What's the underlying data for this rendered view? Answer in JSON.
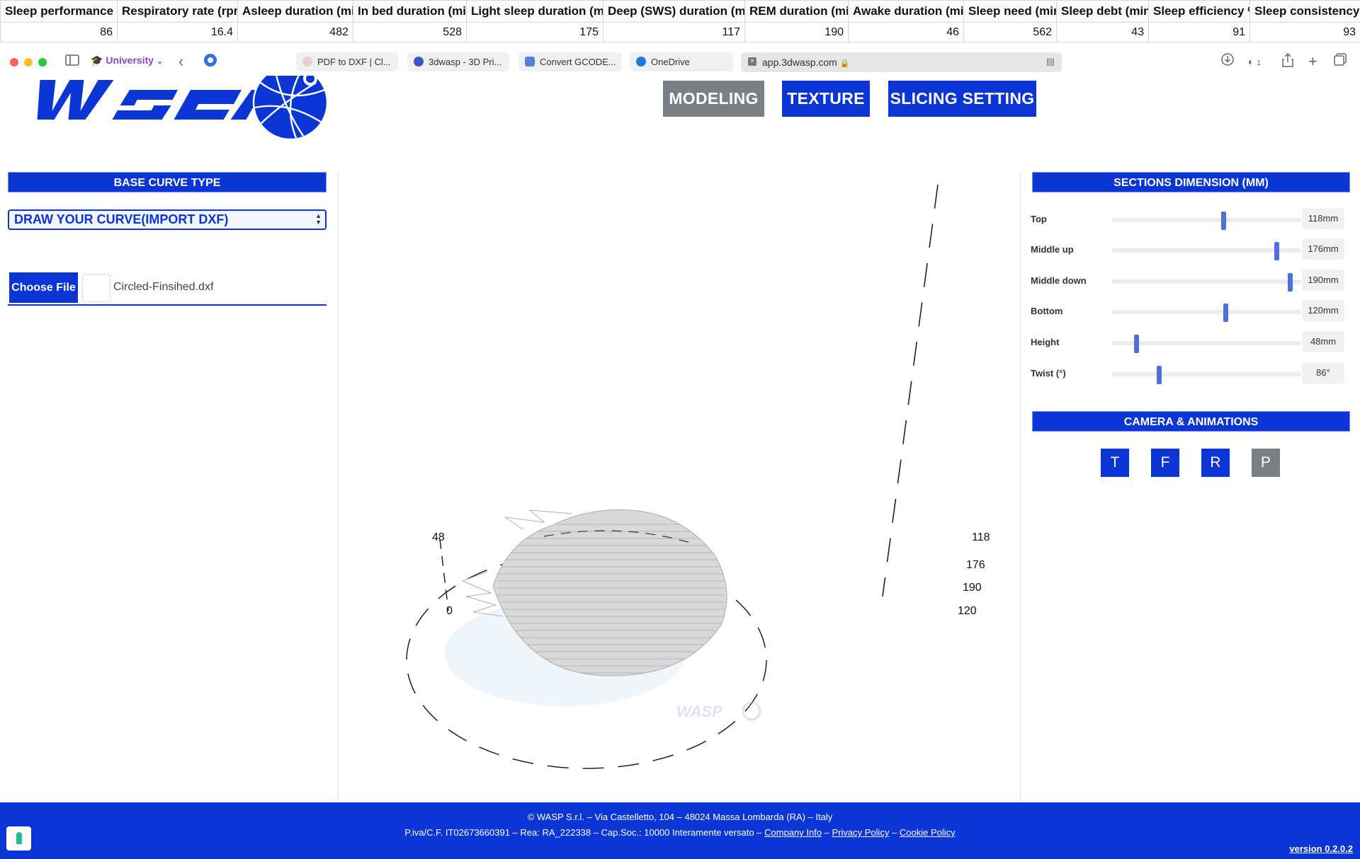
{
  "sheet": {
    "headers": [
      "Sleep performance %",
      "Respiratory rate (rpm)",
      "Asleep duration (min)",
      "In bed duration (min)",
      "Light sleep duration (min)",
      "Deep (SWS) duration (min)",
      "REM duration (min)",
      "Awake duration (min)",
      "Sleep need (min)",
      "Sleep debt (min)",
      "Sleep efficiency %",
      "Sleep consistency %"
    ],
    "values": [
      "86",
      "16.4",
      "482",
      "528",
      "175",
      "117",
      "190",
      "46",
      "562",
      "43",
      "91",
      "93"
    ]
  },
  "browser": {
    "profile": "University",
    "tabs": [
      "PDF to DXF | Cl...",
      "3dwasp - 3D Pri...",
      "Convert GCODE...",
      "OneDrive"
    ],
    "address": "app.3dwasp.com",
    "shield_count": "1"
  },
  "nav": {
    "modeling": "MODELING",
    "texture": "TEXTURE",
    "slicing": "SLICING SETTING"
  },
  "left": {
    "base_curve_title": "BASE CURVE TYPE",
    "curve_select": "DRAW YOUR CURVE(IMPORT DXF)",
    "choose_file": "Choose File",
    "file_name": "Circled-Finsihed.dxf"
  },
  "viewport": {
    "height_top": "48",
    "height_bottom": "0",
    "sections": [
      "118",
      "176",
      "190",
      "120"
    ],
    "watermark": "WASP"
  },
  "right": {
    "sections_title": "SECTIONS DIMENSION (MM)",
    "sliders": [
      {
        "label": "Top",
        "value": "118mm",
        "fraction": 0.59
      },
      {
        "label": "Middle up",
        "value": "176mm",
        "fraction": 0.87
      },
      {
        "label": "Middle down",
        "value": "190mm",
        "fraction": 0.94
      },
      {
        "label": "Bottom",
        "value": "120mm",
        "fraction": 0.6
      },
      {
        "label": "Height",
        "value": "48mm",
        "fraction": 0.13
      },
      {
        "label": "Twist (°)",
        "value": "86°",
        "fraction": 0.25
      }
    ],
    "camera_title": "CAMERA & ANIMATIONS",
    "camera_buttons": [
      "T",
      "F",
      "R",
      "P"
    ]
  },
  "footer": {
    "line1": "© WASP S.r.l. –  Via Castelletto, 104  –  48024 Massa Lombarda (RA) – Italy",
    "line2_prefix": "P.iva/C.F. IT02673660391 – Rea: RA_222338 – Cap.Soc.: 10000 Interamente versato – ",
    "company_info": "Company Info",
    "privacy": "Privacy Policy",
    "cookie": "Cookie Policy",
    "version": "version 0.2.0.2"
  },
  "colors": {
    "brand_blue": "#0b35d4",
    "inactive_gray": "#7a7f84",
    "slider_thumb": "#4e6fdc"
  }
}
